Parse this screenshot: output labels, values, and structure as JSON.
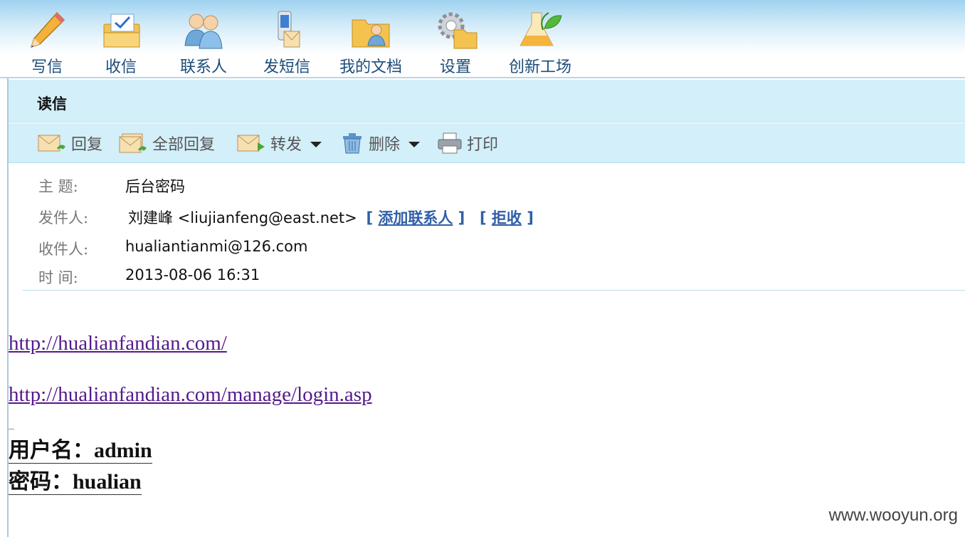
{
  "nav": {
    "items": [
      {
        "label": "写信",
        "icon": "pencil-icon"
      },
      {
        "label": "收信",
        "icon": "inbox-icon"
      },
      {
        "label": "联系人",
        "icon": "contacts-icon"
      },
      {
        "label": "发短信",
        "icon": "sms-icon"
      },
      {
        "label": "我的文档",
        "icon": "documents-icon"
      },
      {
        "label": "设置",
        "icon": "settings-icon"
      },
      {
        "label": "创新工场",
        "icon": "flask-icon"
      }
    ]
  },
  "read": {
    "title": "读信"
  },
  "toolbar": {
    "reply": "回复",
    "reply_all": "全部回复",
    "forward": "转发",
    "delete": "删除",
    "print": "打印"
  },
  "meta": {
    "subject_label": "主  题:",
    "subject": "后台密码",
    "from_label": "发件人:",
    "from": "刘建峰 <liujianfeng@east.net>",
    "add_contact": "添加联系人",
    "reject": "拒收",
    "to_label": "收件人:",
    "to": "hualiantianmi@126.com",
    "time_label": "时  间:",
    "time": "2013-08-06 16:31"
  },
  "body": {
    "link1": "http://hualianfandian.com/",
    "link2": "http://hualianfandian.com/manage/login.asp",
    "username_line": "用户名：admin",
    "password_line": "密码：hualian"
  },
  "watermark": "www.wooyun.org"
}
